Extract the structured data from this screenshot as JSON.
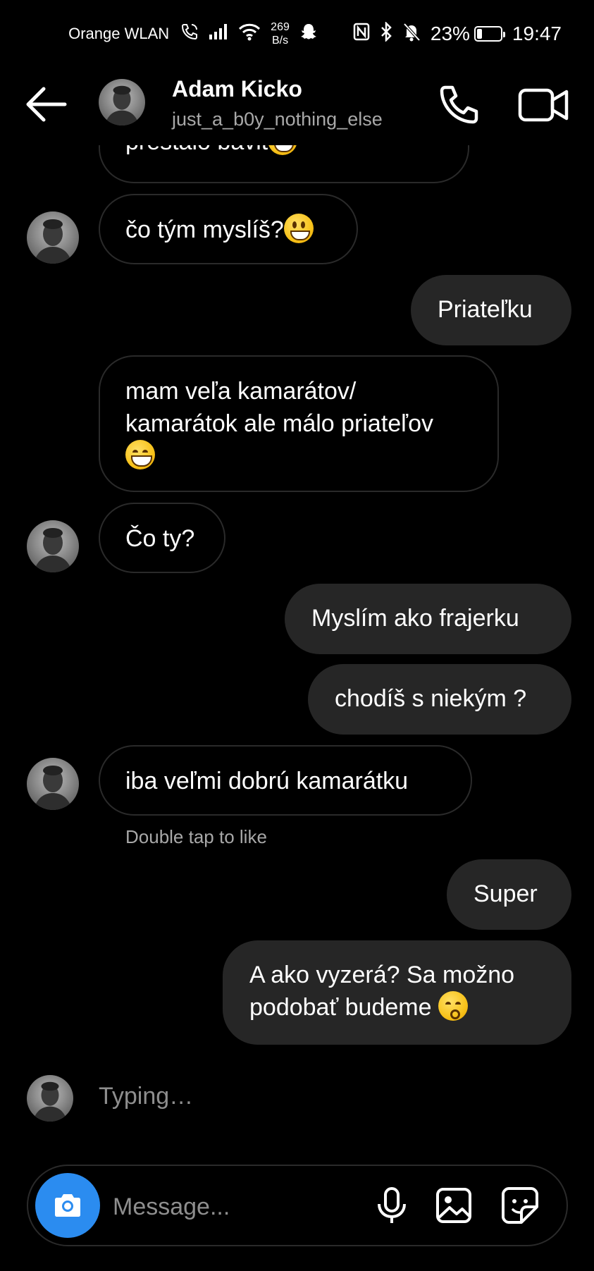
{
  "status_bar": {
    "carrier": "Orange WLAN",
    "net_speed_value": "269",
    "net_speed_unit": "B/s",
    "battery_percent": "23%",
    "battery_level": 0.23,
    "time": "19:47",
    "icons": [
      "wifi-call-icon",
      "signal-icon",
      "wifi-icon",
      "snapchat-icon",
      "nfc-icon",
      "bluetooth-icon",
      "bell-muted-icon",
      "battery-icon"
    ]
  },
  "header": {
    "name": "Adam Kicko",
    "username": "just_a_b0y_nothing_else",
    "icons": [
      "back-arrow-icon",
      "phone-icon",
      "video-camera-icon"
    ]
  },
  "messages": [
    {
      "direction": "in",
      "text": "prestalo bavit",
      "emoji": "grin"
    },
    {
      "direction": "in",
      "text": "čo tým myslíš?",
      "emoji": "grin"
    },
    {
      "direction": "out",
      "text": "Priateľku"
    },
    {
      "direction": "in",
      "text": "mam veľa kamarátov/ kamarátok ale málo priateľov",
      "emoji": "sweat"
    },
    {
      "direction": "in",
      "text": "Čo ty?"
    },
    {
      "direction": "out",
      "text": "Myslím ako frajerku"
    },
    {
      "direction": "out",
      "text": "chodíš s niekým ?"
    },
    {
      "direction": "in",
      "text": "iba veľmi dobrú kamarátku"
    },
    {
      "direction": "out",
      "text": "Super"
    },
    {
      "direction": "out",
      "text": "A ako vyzerá? Sa možno podobať budeme",
      "emoji": "kiss"
    }
  ],
  "hint": "Double tap to like",
  "typing": "Typing…",
  "composer": {
    "placeholder": "Message...",
    "icons": [
      "camera-icon",
      "microphone-icon",
      "gallery-icon",
      "sticker-icon"
    ]
  },
  "colors": {
    "background": "#000000",
    "outgoing_bubble": "#262626",
    "incoming_border": "#2a2a2a",
    "camera_button": "#2b8cf0",
    "muted_text": "#a8a8a8"
  }
}
